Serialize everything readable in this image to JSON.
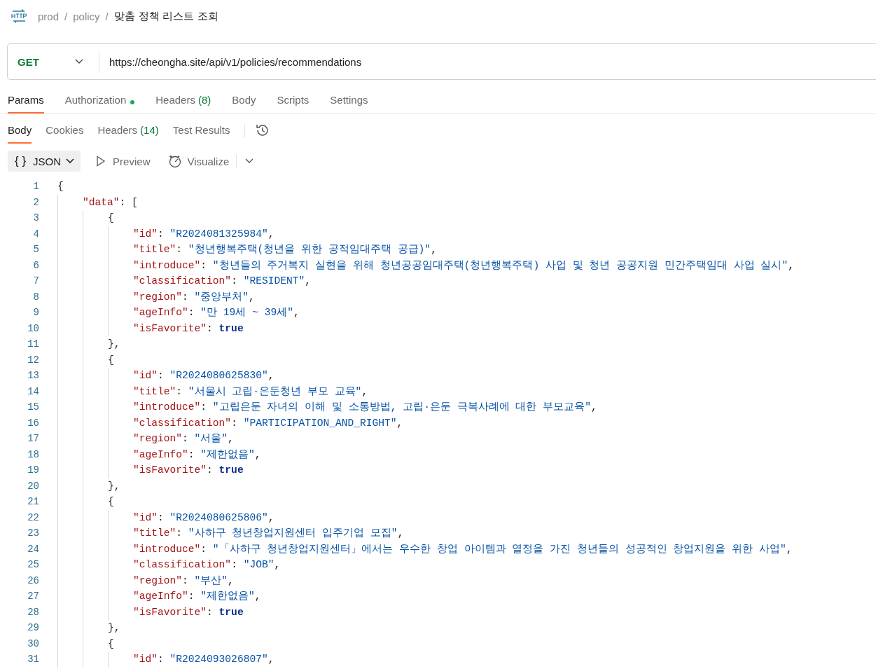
{
  "breadcrumb": {
    "items": [
      "prod",
      "policy"
    ],
    "separator": "/",
    "title": "맞춤 정책 리스트 조회"
  },
  "request": {
    "method": "GET",
    "url": "https://cheongha.site/api/v1/policies/recommendations"
  },
  "request_tabs": [
    {
      "label": "Params",
      "selected": true,
      "indicator": false
    },
    {
      "label": "Authorization",
      "selected": false,
      "indicator": true
    },
    {
      "label": "Headers",
      "count": "(8)",
      "selected": false,
      "indicator": false
    },
    {
      "label": "Body",
      "selected": false,
      "indicator": false
    },
    {
      "label": "Scripts",
      "selected": false,
      "indicator": false
    },
    {
      "label": "Settings",
      "selected": false,
      "indicator": false
    }
  ],
  "response_tabs": [
    {
      "label": "Body",
      "selected": true
    },
    {
      "label": "Cookies",
      "selected": false
    },
    {
      "label": "Headers",
      "count": "(14)",
      "selected": false
    },
    {
      "label": "Test Results",
      "selected": false
    }
  ],
  "toolbar": {
    "format_icon": "{ }",
    "format": "JSON",
    "preview": "Preview",
    "visualize": "Visualize"
  },
  "code": [
    {
      "number": "1",
      "tokens": [
        {
          "kind": "punct",
          "text": "{"
        }
      ],
      "children": [
        {
          "number": "2",
          "tokens": [
            {
              "kind": "key",
              "text": "\"data\""
            },
            {
              "kind": "punct",
              "text": ": ["
            }
          ],
          "children": [
            {
              "number": "3",
              "tokens": [
                {
                  "kind": "punct",
                  "text": "{"
                }
              ],
              "children": [
                {
                  "number": "4",
                  "tokens": [
                    {
                      "kind": "key",
                      "text": "\"id\""
                    },
                    {
                      "kind": "punct",
                      "text": ": "
                    },
                    {
                      "kind": "string",
                      "text": "\"R2024081325984\""
                    },
                    {
                      "kind": "punct",
                      "text": ","
                    }
                  ]
                },
                {
                  "number": "5",
                  "tokens": [
                    {
                      "kind": "key",
                      "text": "\"title\""
                    },
                    {
                      "kind": "punct",
                      "text": ": "
                    },
                    {
                      "kind": "string",
                      "text": "\"청년행복주택(청년을 위한 공적임대주택 공급)\""
                    },
                    {
                      "kind": "punct",
                      "text": ","
                    }
                  ]
                },
                {
                  "number": "6",
                  "tokens": [
                    {
                      "kind": "key",
                      "text": "\"introduce\""
                    },
                    {
                      "kind": "punct",
                      "text": ": "
                    },
                    {
                      "kind": "string",
                      "text": "\"청년들의 주거복지 실현을 위해 청년공공임대주택(청년행복주택) 사업 및 청년 공공지원 민간주택임대 사업 실시\""
                    },
                    {
                      "kind": "punct",
                      "text": ","
                    }
                  ]
                },
                {
                  "number": "7",
                  "tokens": [
                    {
                      "kind": "key",
                      "text": "\"classification\""
                    },
                    {
                      "kind": "punct",
                      "text": ": "
                    },
                    {
                      "kind": "string",
                      "text": "\"RESIDENT\""
                    },
                    {
                      "kind": "punct",
                      "text": ","
                    }
                  ]
                },
                {
                  "number": "8",
                  "tokens": [
                    {
                      "kind": "key",
                      "text": "\"region\""
                    },
                    {
                      "kind": "punct",
                      "text": ": "
                    },
                    {
                      "kind": "string",
                      "text": "\"중앙부처\""
                    },
                    {
                      "kind": "punct",
                      "text": ","
                    }
                  ]
                },
                {
                  "number": "9",
                  "tokens": [
                    {
                      "kind": "key",
                      "text": "\"ageInfo\""
                    },
                    {
                      "kind": "punct",
                      "text": ": "
                    },
                    {
                      "kind": "string",
                      "text": "\"만 19세 ~ 39세\""
                    },
                    {
                      "kind": "punct",
                      "text": ","
                    }
                  ]
                },
                {
                  "number": "10",
                  "tokens": [
                    {
                      "kind": "key",
                      "text": "\"isFavorite\""
                    },
                    {
                      "kind": "punct",
                      "text": ": "
                    },
                    {
                      "kind": "bool",
                      "text": "true"
                    }
                  ]
                }
              ]
            },
            {
              "number": "11",
              "tokens": [
                {
                  "kind": "punct",
                  "text": "},"
                }
              ]
            },
            {
              "number": "12",
              "tokens": [
                {
                  "kind": "punct",
                  "text": "{"
                }
              ],
              "children": [
                {
                  "number": "13",
                  "tokens": [
                    {
                      "kind": "key",
                      "text": "\"id\""
                    },
                    {
                      "kind": "punct",
                      "text": ": "
                    },
                    {
                      "kind": "string",
                      "text": "\"R2024080625830\""
                    },
                    {
                      "kind": "punct",
                      "text": ","
                    }
                  ]
                },
                {
                  "number": "14",
                  "tokens": [
                    {
                      "kind": "key",
                      "text": "\"title\""
                    },
                    {
                      "kind": "punct",
                      "text": ": "
                    },
                    {
                      "kind": "string",
                      "text": "\"서울시 고립·은둔청년 부모 교육\""
                    },
                    {
                      "kind": "punct",
                      "text": ","
                    }
                  ]
                },
                {
                  "number": "15",
                  "tokens": [
                    {
                      "kind": "key",
                      "text": "\"introduce\""
                    },
                    {
                      "kind": "punct",
                      "text": ": "
                    },
                    {
                      "kind": "string",
                      "text": "\"고립은둔 자녀의 이해 및 소통방법, 고립·은둔 극복사례에 대한 부모교육\""
                    },
                    {
                      "kind": "punct",
                      "text": ","
                    }
                  ]
                },
                {
                  "number": "16",
                  "tokens": [
                    {
                      "kind": "key",
                      "text": "\"classification\""
                    },
                    {
                      "kind": "punct",
                      "text": ": "
                    },
                    {
                      "kind": "string",
                      "text": "\"PARTICIPATION_AND_RIGHT\""
                    },
                    {
                      "kind": "punct",
                      "text": ","
                    }
                  ]
                },
                {
                  "number": "17",
                  "tokens": [
                    {
                      "kind": "key",
                      "text": "\"region\""
                    },
                    {
                      "kind": "punct",
                      "text": ": "
                    },
                    {
                      "kind": "string",
                      "text": "\"서울\""
                    },
                    {
                      "kind": "punct",
                      "text": ","
                    }
                  ]
                },
                {
                  "number": "18",
                  "tokens": [
                    {
                      "kind": "key",
                      "text": "\"ageInfo\""
                    },
                    {
                      "kind": "punct",
                      "text": ": "
                    },
                    {
                      "kind": "string",
                      "text": "\"제한없음\""
                    },
                    {
                      "kind": "punct",
                      "text": ","
                    }
                  ]
                },
                {
                  "number": "19",
                  "tokens": [
                    {
                      "kind": "key",
                      "text": "\"isFavorite\""
                    },
                    {
                      "kind": "punct",
                      "text": ": "
                    },
                    {
                      "kind": "bool",
                      "text": "true"
                    }
                  ]
                }
              ]
            },
            {
              "number": "20",
              "tokens": [
                {
                  "kind": "punct",
                  "text": "},"
                }
              ]
            },
            {
              "number": "21",
              "tokens": [
                {
                  "kind": "punct",
                  "text": "{"
                }
              ],
              "children": [
                {
                  "number": "22",
                  "tokens": [
                    {
                      "kind": "key",
                      "text": "\"id\""
                    },
                    {
                      "kind": "punct",
                      "text": ": "
                    },
                    {
                      "kind": "string",
                      "text": "\"R2024080625806\""
                    },
                    {
                      "kind": "punct",
                      "text": ","
                    }
                  ]
                },
                {
                  "number": "23",
                  "tokens": [
                    {
                      "kind": "key",
                      "text": "\"title\""
                    },
                    {
                      "kind": "punct",
                      "text": ": "
                    },
                    {
                      "kind": "string",
                      "text": "\"사하구 청년창업지원센터 입주기업 모집\""
                    },
                    {
                      "kind": "punct",
                      "text": ","
                    }
                  ]
                },
                {
                  "number": "24",
                  "tokens": [
                    {
                      "kind": "key",
                      "text": "\"introduce\""
                    },
                    {
                      "kind": "punct",
                      "text": ": "
                    },
                    {
                      "kind": "string",
                      "text": "\"「사하구 청년창업지원센터」에서는 우수한 창업 아이템과 열정을 가진 청년들의 성공적인 창업지원을 위한 사업\""
                    },
                    {
                      "kind": "punct",
                      "text": ","
                    }
                  ]
                },
                {
                  "number": "25",
                  "tokens": [
                    {
                      "kind": "key",
                      "text": "\"classification\""
                    },
                    {
                      "kind": "punct",
                      "text": ": "
                    },
                    {
                      "kind": "string",
                      "text": "\"JOB\""
                    },
                    {
                      "kind": "punct",
                      "text": ","
                    }
                  ]
                },
                {
                  "number": "26",
                  "tokens": [
                    {
                      "kind": "key",
                      "text": "\"region\""
                    },
                    {
                      "kind": "punct",
                      "text": ": "
                    },
                    {
                      "kind": "string",
                      "text": "\"부산\""
                    },
                    {
                      "kind": "punct",
                      "text": ","
                    }
                  ]
                },
                {
                  "number": "27",
                  "tokens": [
                    {
                      "kind": "key",
                      "text": "\"ageInfo\""
                    },
                    {
                      "kind": "punct",
                      "text": ": "
                    },
                    {
                      "kind": "string",
                      "text": "\"제한없음\""
                    },
                    {
                      "kind": "punct",
                      "text": ","
                    }
                  ]
                },
                {
                  "number": "28",
                  "tokens": [
                    {
                      "kind": "key",
                      "text": "\"isFavorite\""
                    },
                    {
                      "kind": "punct",
                      "text": ": "
                    },
                    {
                      "kind": "bool",
                      "text": "true"
                    }
                  ]
                }
              ]
            },
            {
              "number": "29",
              "tokens": [
                {
                  "kind": "punct",
                  "text": "},"
                }
              ]
            },
            {
              "number": "30",
              "tokens": [
                {
                  "kind": "punct",
                  "text": "{"
                }
              ],
              "children": [
                {
                  "number": "31",
                  "tokens": [
                    {
                      "kind": "key",
                      "text": "\"id\""
                    },
                    {
                      "kind": "punct",
                      "text": ": "
                    },
                    {
                      "kind": "string",
                      "text": "\"R2024093026807\""
                    },
                    {
                      "kind": "punct",
                      "text": ","
                    }
                  ]
                }
              ]
            }
          ]
        }
      ]
    }
  ]
}
